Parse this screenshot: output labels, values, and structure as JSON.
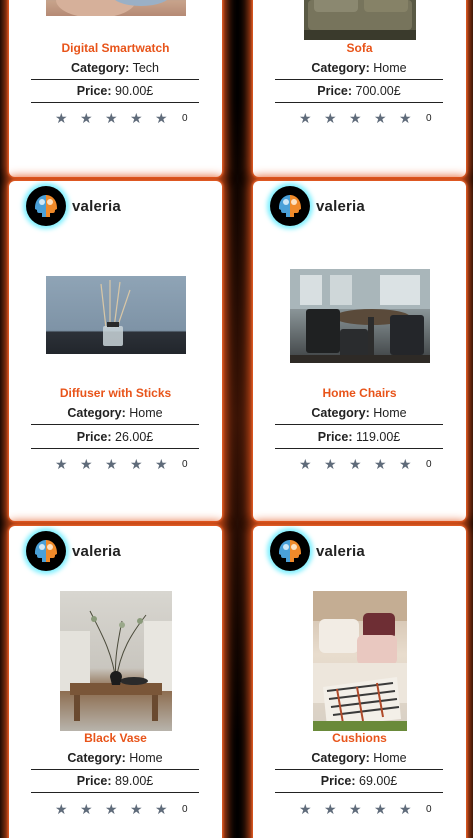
{
  "cards": [
    {
      "owner": "",
      "title": "Digital Smartwatch",
      "category_label": "Category:",
      "category": "Tech",
      "price_label": "Price:",
      "price": "90.00£",
      "rating_count": "0"
    },
    {
      "owner": "",
      "title": "Sofa",
      "category_label": "Category:",
      "category": "Home",
      "price_label": "Price:",
      "price": "700.00£",
      "rating_count": "0"
    },
    {
      "owner": "valeria",
      "title": "Diffuser with Sticks",
      "category_label": "Category:",
      "category": "Home",
      "price_label": "Price:",
      "price": "26.00£",
      "rating_count": "0"
    },
    {
      "owner": "valeria",
      "title": "Home Chairs",
      "category_label": "Category:",
      "category": "Home",
      "price_label": "Price:",
      "price": "119.00£",
      "rating_count": "0"
    },
    {
      "owner": "valeria",
      "title": "Black Vase",
      "category_label": "Category:",
      "category": "Home",
      "price_label": "Price:",
      "price": "89.00£",
      "rating_count": "0"
    },
    {
      "owner": "valeria",
      "title": "Cushions",
      "category_label": "Category:",
      "category": "Home",
      "price_label": "Price:",
      "price": "69.00£",
      "rating_count": "0"
    }
  ],
  "star_glyph": "★",
  "colors": {
    "accent": "#e8541a",
    "glow": "#e2531a",
    "star": "#5f6b7a",
    "avatar_ring": "#7ff0ff"
  }
}
